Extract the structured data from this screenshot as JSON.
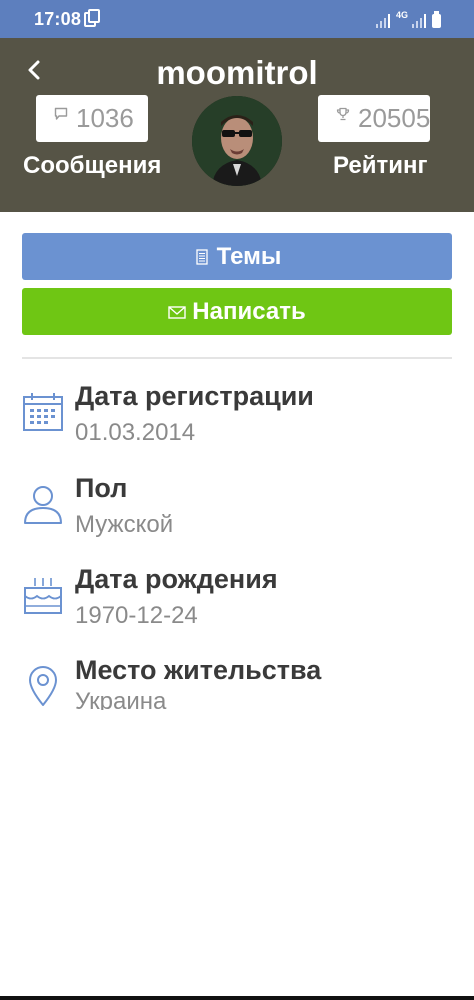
{
  "status_bar": {
    "time": "17:08",
    "network": "4G",
    "icons": [
      "sim-card-icon",
      "signal-icon",
      "signal-icon",
      "battery-icon"
    ]
  },
  "header": {
    "username": "moomitrol",
    "back_icon": "chevron-left-icon",
    "posts": {
      "icon": "chat-bubble-icon",
      "count": "1036",
      "label": "Сообщения"
    },
    "rating": {
      "icon": "trophy-icon",
      "count": "20505",
      "label": "Рейтинг"
    },
    "avatar": "avatar"
  },
  "actions": {
    "topics": {
      "icon": "document-icon",
      "label": "Темы",
      "color": "#6b92d1"
    },
    "write": {
      "icon": "envelope-icon",
      "label": "Написать",
      "color": "#6fc614"
    }
  },
  "info": [
    {
      "icon": "calendar-icon",
      "title": "Дата регистрации",
      "value": "01.03.2014"
    },
    {
      "icon": "person-icon",
      "title": "Пол",
      "value": "Мужской"
    },
    {
      "icon": "birthday-cake-icon",
      "title": "Дата рождения",
      "value": "1970-12-24"
    },
    {
      "icon": "location-pin-icon",
      "title": "Место жительства",
      "value": "Украина"
    }
  ],
  "colors": {
    "status_bar": "#5d7fbe",
    "header": "#565446",
    "icon_accent": "#6b92d1"
  }
}
